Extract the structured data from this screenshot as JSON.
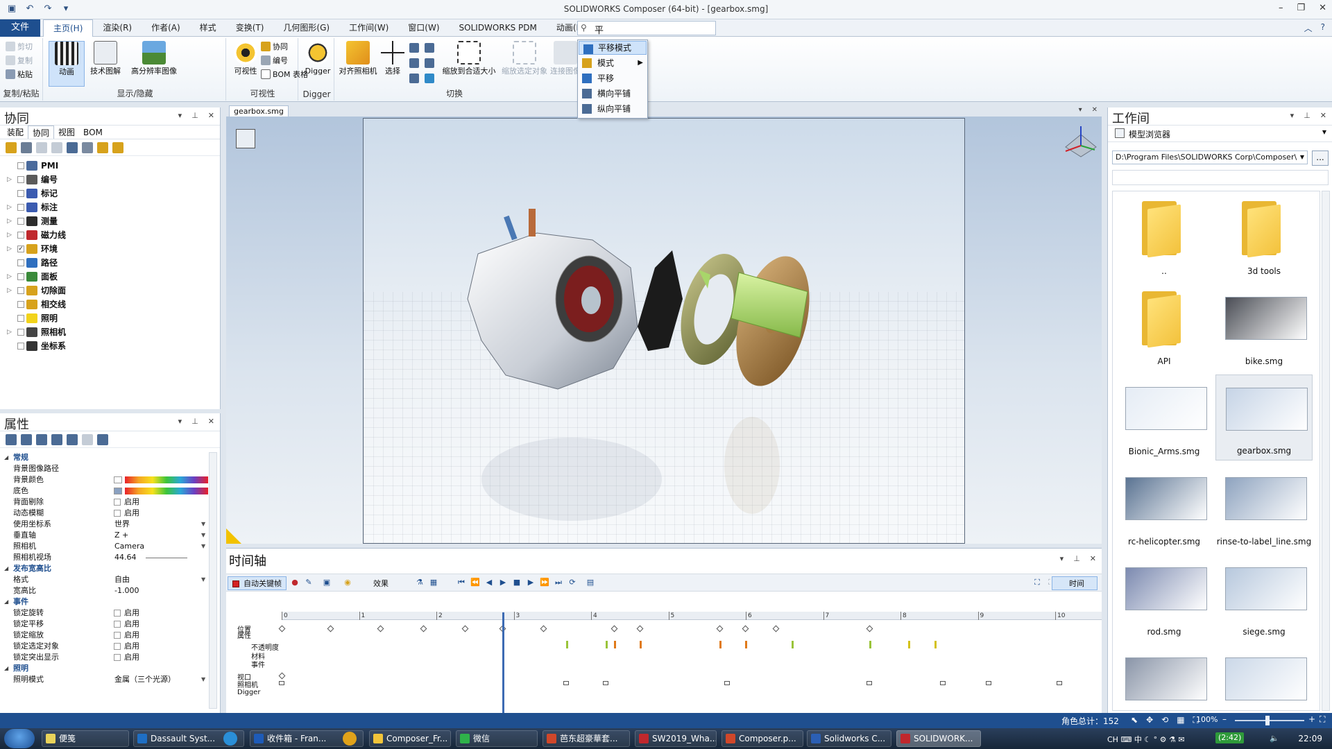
{
  "window": {
    "title": "SOLIDWORKS Composer (64-bit) - [gearbox.smg]"
  },
  "ribbon_tabs": {
    "file": "文件",
    "tabs": [
      "主页(H)",
      "渲染(R)",
      "作者(A)",
      "样式",
      "变换(T)",
      "几何图形(G)",
      "工作间(W)",
      "窗口(W)",
      "SOLIDWORKS PDM",
      "动画(M)"
    ],
    "active_index": 0,
    "search_value": "平"
  },
  "ribbon": {
    "clipboard": {
      "cut": "剪切",
      "copy": "复制",
      "paste": "粘贴",
      "label": "复制/粘贴"
    },
    "show_hide": {
      "animation": "动画",
      "tech_illustration": "技术图解",
      "hires_image": "高分辨率图像",
      "label": "显示/隐藏"
    },
    "visibility": {
      "visibility": "可视性",
      "collab": "协同",
      "numbering": "编号",
      "bom_table": "BOM 表格",
      "label": "可视性"
    },
    "digger": {
      "digger": "Digger",
      "label": "Digger"
    },
    "switch": {
      "align_camera": "对齐照相机",
      "select": "选择",
      "zoom_fit": "缩放到合适大小",
      "zoom_selected": "缩放选定对象",
      "connect_image": "连接图像",
      "label": "切换"
    }
  },
  "dropdown": {
    "items": [
      {
        "label": "平移模式",
        "highlight": true
      },
      {
        "label": "模式",
        "submenu": true
      },
      {
        "label": "平移"
      },
      {
        "label": "横向平铺"
      },
      {
        "label": "纵向平铺"
      }
    ]
  },
  "collab_panel": {
    "title": "协同",
    "subtabs": [
      "装配",
      "协同",
      "视图",
      "BOM"
    ],
    "active_subtab": 1,
    "tree": [
      {
        "label": "PMI",
        "expandable": false,
        "checked": false,
        "color": "#4a6a9c"
      },
      {
        "label": "编号",
        "expandable": true,
        "checked": false,
        "color": "#5a5a5a"
      },
      {
        "label": "标记",
        "expandable": false,
        "checked": false,
        "color": "#3b5bb0"
      },
      {
        "label": "标注",
        "expandable": true,
        "checked": false,
        "color": "#3b5bb0"
      },
      {
        "label": "测量",
        "expandable": true,
        "checked": false,
        "color": "#2c2c2c"
      },
      {
        "label": "磁力线",
        "expandable": true,
        "checked": false,
        "color": "#c0282d"
      },
      {
        "label": "环境",
        "expandable": true,
        "checked": true,
        "color": "#d7a21c"
      },
      {
        "label": "路径",
        "expandable": false,
        "checked": false,
        "color": "#2f6fbf"
      },
      {
        "label": "面板",
        "expandable": true,
        "checked": false,
        "color": "#3a8a3a"
      },
      {
        "label": "切除面",
        "expandable": true,
        "checked": false,
        "color": "#d7a21c"
      },
      {
        "label": "相交线",
        "expandable": false,
        "checked": false,
        "color": "#d7a21c"
      },
      {
        "label": "照明",
        "expandable": false,
        "checked": false,
        "color": "#f2d31a"
      },
      {
        "label": "照相机",
        "expandable": true,
        "checked": false,
        "color": "#444444"
      },
      {
        "label": "坐标系",
        "expandable": false,
        "checked": false,
        "color": "#333333"
      }
    ]
  },
  "props_panel": {
    "title": "属性",
    "rows": [
      {
        "type": "cat",
        "label": "常规"
      },
      {
        "type": "text",
        "label": "背景图像路径",
        "value": ""
      },
      {
        "type": "color",
        "label": "背景颜色",
        "swatch": "#ffffff"
      },
      {
        "type": "color",
        "label": "底色",
        "swatch": "#8aa0c0"
      },
      {
        "type": "check",
        "label": "背面剔除",
        "value": "启用"
      },
      {
        "type": "check",
        "label": "动态模糊",
        "value": "启用"
      },
      {
        "type": "select",
        "label": "使用坐标系",
        "value": "世界"
      },
      {
        "type": "select",
        "label": "垂直轴",
        "value": "Z +"
      },
      {
        "type": "select",
        "label": "照相机",
        "value": "Camera"
      },
      {
        "type": "slider",
        "label": "照相机视场",
        "value": "44.64"
      },
      {
        "type": "cat",
        "label": "发布宽高比"
      },
      {
        "type": "select",
        "label": "格式",
        "value": "自由"
      },
      {
        "type": "text",
        "label": "宽高比",
        "value": "-1.000"
      },
      {
        "type": "cat",
        "label": "事件"
      },
      {
        "type": "check",
        "label": "锁定旋转",
        "value": "启用"
      },
      {
        "type": "check",
        "label": "锁定平移",
        "value": "启用"
      },
      {
        "type": "check",
        "label": "锁定缩放",
        "value": "启用"
      },
      {
        "type": "check",
        "label": "锁定选定对象",
        "value": "启用"
      },
      {
        "type": "check",
        "label": "锁定突出显示",
        "value": "启用"
      },
      {
        "type": "cat",
        "label": "照明"
      },
      {
        "type": "select",
        "label": "照明模式",
        "value": "金属（三个光源）"
      }
    ]
  },
  "document": {
    "tab": "gearbox.smg"
  },
  "timeline": {
    "title": "时间轴",
    "auto_key": "自动关键帧",
    "effects": "效果",
    "time_mode": "时间",
    "tracks": [
      "位置",
      "属性",
      "不透明度",
      "材料",
      "事件",
      "视口",
      "照相机",
      "Digger"
    ],
    "ruler_ticks": [
      "0",
      "1",
      "2",
      "3",
      "4",
      "5",
      "6",
      "7",
      "8",
      "9",
      "10"
    ],
    "playhead_time": 2.85
  },
  "workshop_panel": {
    "title": "工作间",
    "browser": "模型浏览器",
    "path": "D:\\Program Files\\SOLIDWORKS Corp\\Composer\\",
    "browse_btn": "...",
    "thumbnails": [
      {
        "label": "..",
        "kind": "folder"
      },
      {
        "label": "3d tools",
        "kind": "folder"
      },
      {
        "label": "API",
        "kind": "folder"
      },
      {
        "label": "bike.smg",
        "kind": "file",
        "color": "#4a4d55"
      },
      {
        "label": "Bionic_Arms.smg",
        "kind": "file",
        "color": "#e5ecf5"
      },
      {
        "label": "gearbox.smg",
        "kind": "file",
        "color": "#c6d4e6",
        "selected": true
      },
      {
        "label": "rc-helicopter.smg",
        "kind": "file",
        "color": "#5a7392"
      },
      {
        "label": "rinse-to-label_line.smg",
        "kind": "file",
        "color": "#8ea3bf"
      },
      {
        "label": "rod.smg",
        "kind": "file",
        "color": "#7c8ab0"
      },
      {
        "label": "siege.smg",
        "kind": "file",
        "color": "#b7c8dd"
      },
      {
        "label": "",
        "kind": "file",
        "color": "#8a95a8"
      },
      {
        "label": "",
        "kind": "file",
        "color": "#cbd8e8"
      }
    ]
  },
  "statusbar": {
    "faces": "角色总计：152",
    "zoom": "100%"
  },
  "taskbar": {
    "items": [
      "便笺",
      "Dassault Syst...",
      "收件箱 - Fran...",
      "Composer_Fr...",
      "微信",
      "芭东超豪華套...",
      "SW2019_Wha...",
      "Composer.p...",
      "Solidworks C...",
      "SOLIDWORK..."
    ],
    "active_index": 9,
    "clock": "22:09",
    "network": "(2:42)"
  }
}
